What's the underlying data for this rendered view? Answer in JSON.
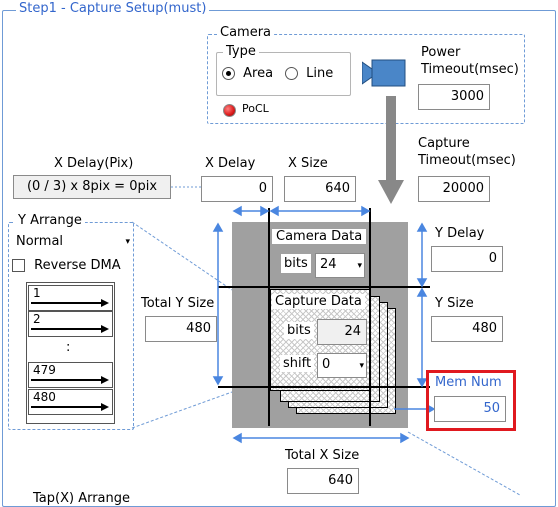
{
  "step_title": "Step1 - Capture Setup(must)",
  "camera": {
    "title": "Camera",
    "type_title": "Type",
    "type_options": [
      "Area",
      "Line"
    ],
    "selected_type": "Area",
    "status_label": "PoCL",
    "power_timeout_label_1": "Power",
    "power_timeout_label_2": "Timeout(msec)",
    "power_timeout_value": "3000"
  },
  "capture_timeout": {
    "label_1": "Capture",
    "label_2": "Timeout(msec)",
    "value": "20000"
  },
  "x_delay_pix": {
    "label": "X Delay(Pix)",
    "formula": "(0 / 3) x 8pix = 0pix"
  },
  "x_delay": {
    "label": "X Delay",
    "value": "0"
  },
  "x_size": {
    "label": "X Size",
    "value": "640"
  },
  "y_arrange": {
    "title": "Y Arrange",
    "mode": "Normal",
    "reverse_dma_label": "Reverse DMA",
    "reverse_dma_checked": false,
    "rows_top": [
      "1",
      "2"
    ],
    "ellipsis": ":",
    "rows_bottom": [
      "479",
      "480"
    ]
  },
  "camera_data": {
    "title": "Camera Data",
    "bits_label": "bits",
    "bits_value": "24"
  },
  "capture_data": {
    "title": "Capture Data",
    "bits_label": "bits",
    "bits_value": "24",
    "shift_label": "shift",
    "shift_value": "0"
  },
  "y_delay": {
    "label": "Y Delay",
    "value": "0"
  },
  "y_size": {
    "label": "Y Size",
    "value": "480"
  },
  "total_y_size": {
    "label": "Total Y Size",
    "value": "480"
  },
  "total_x_size": {
    "label": "Total X Size",
    "value": "640"
  },
  "mem_num": {
    "label": "Mem Num",
    "value": "50"
  },
  "tap_x_arrange": {
    "label": "Tap(X) Arrange"
  },
  "colors": {
    "panel_border": "#6f9bd6",
    "accent_text": "#3366cc",
    "highlight_border": "#e0191f",
    "sensor_gray": "#a0a0a0",
    "status_led": "#e02020",
    "camera_icon": "#4a86c8"
  }
}
